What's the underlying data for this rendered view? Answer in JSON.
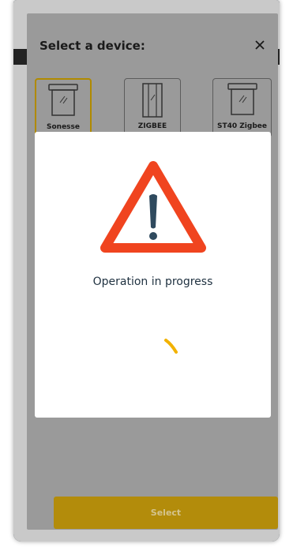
{
  "dialog": {
    "title": "Select a device:",
    "close_icon": "close-icon",
    "devices": [
      {
        "label": "Sonesse",
        "icon": "window-frame-icon",
        "selected": true
      },
      {
        "label": "ZIGBEE",
        "icon": "curtain-panel-icon",
        "selected": false
      },
      {
        "label": "ST40 Zigbee",
        "icon": "window-frame-icon",
        "selected": false
      }
    ],
    "select_label": "Select"
  },
  "modal": {
    "icon": "warning-icon",
    "message": "Operation in progress",
    "spinner_icon": "loading-spinner-icon"
  },
  "colors": {
    "accent": "#b38c0b",
    "warning_red": "#f0441f",
    "warning_mark": "#2f4a5e",
    "spinner": "#f2b200",
    "overlay_sheet": "#9a9a9a"
  }
}
